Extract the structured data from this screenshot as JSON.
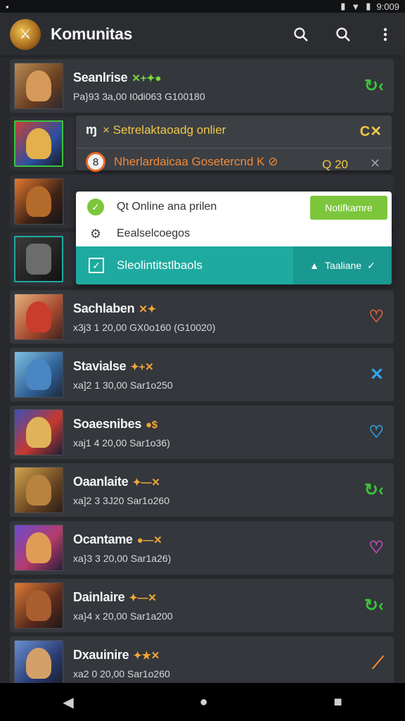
{
  "status": {
    "time": "9:009",
    "icons": [
      "image-icon",
      "signal-icon",
      "wifi-icon",
      "battery-icon"
    ]
  },
  "appbar": {
    "title": "Komunitas"
  },
  "colors": {
    "accent_green": "#3cc33c",
    "accent_orange": "#ef8a3b",
    "accent_yellow": "#f0c847",
    "teal": "#1eaaa0"
  },
  "rows": [
    {
      "name": "Seanlrise",
      "spark": "✕+✦●",
      "meta": "Pa}93 3a,00 I0di063 G100180",
      "trail": "↻‹",
      "trail_color": "#3cc33c"
    },
    {
      "name": "",
      "spark": "",
      "meta": "",
      "trail": "",
      "trail_color": "#3cc33c"
    },
    {
      "name": "",
      "spark": "",
      "meta": "",
      "trail": "",
      "trail_color": "#3cc33c"
    },
    {
      "name": "",
      "spark": "",
      "meta": "",
      "trail": "",
      "trail_color": "#3cc33c"
    },
    {
      "name": "Sachlaben",
      "spark": "✕✦",
      "meta": "x3j3 1 20,00 GX0o160 (G10020)",
      "trail": "♡",
      "trail_color": "#e8643a"
    },
    {
      "name": "Stavialse",
      "spark": "✦+✕",
      "meta": "xa]2 1 30,00 Sar1o250",
      "trail": "✕",
      "trail_color": "#33a3e8"
    },
    {
      "name": "Soaesnibes",
      "spark": "●$",
      "meta": "xaj1 4 20,00 Sar1o36)",
      "trail": "♡",
      "trail_color": "#33a3e8"
    },
    {
      "name": "Oaanlaite",
      "spark": "✦—✕",
      "meta": "xa]2 3 3J20 Sar1o260",
      "trail": "↻‹",
      "trail_color": "#3cc33c"
    },
    {
      "name": "Ocantame",
      "spark": "●—✕",
      "meta": "xa}3 3 20,00 Sar1a26)",
      "trail": "♡",
      "trail_color": "#c64fc6"
    },
    {
      "name": "Dainlaire",
      "spark": "✦—✕",
      "meta": "xa}4 x 20,00 Sar1a200",
      "trail": "↻‹",
      "trail_color": "#3cc33c"
    },
    {
      "name": "Dxauinire",
      "spark": "✦★✕",
      "meta": "xa2 0 20,00 Sar1o260",
      "trail": "⟋",
      "trail_color": "#ef8a3b"
    }
  ],
  "overlay": {
    "lead": "ɱ",
    "line1": "× Setrelaktaoadg onlier",
    "close1": "C✕",
    "line2": "Nherlardaicaa Gosetercnd K ⊘",
    "badge": "8",
    "count": "Q 20",
    "close2": "✕"
  },
  "menu": {
    "item1": "Qt Online ana prilen",
    "notif_button": "Notifkamre",
    "item2": "Eealselcoegos",
    "item3": "Sleolintitstlbaols",
    "teal_button": "Taaliane"
  },
  "navbar": {
    "back": "◀",
    "home": "●",
    "recents": "■"
  }
}
